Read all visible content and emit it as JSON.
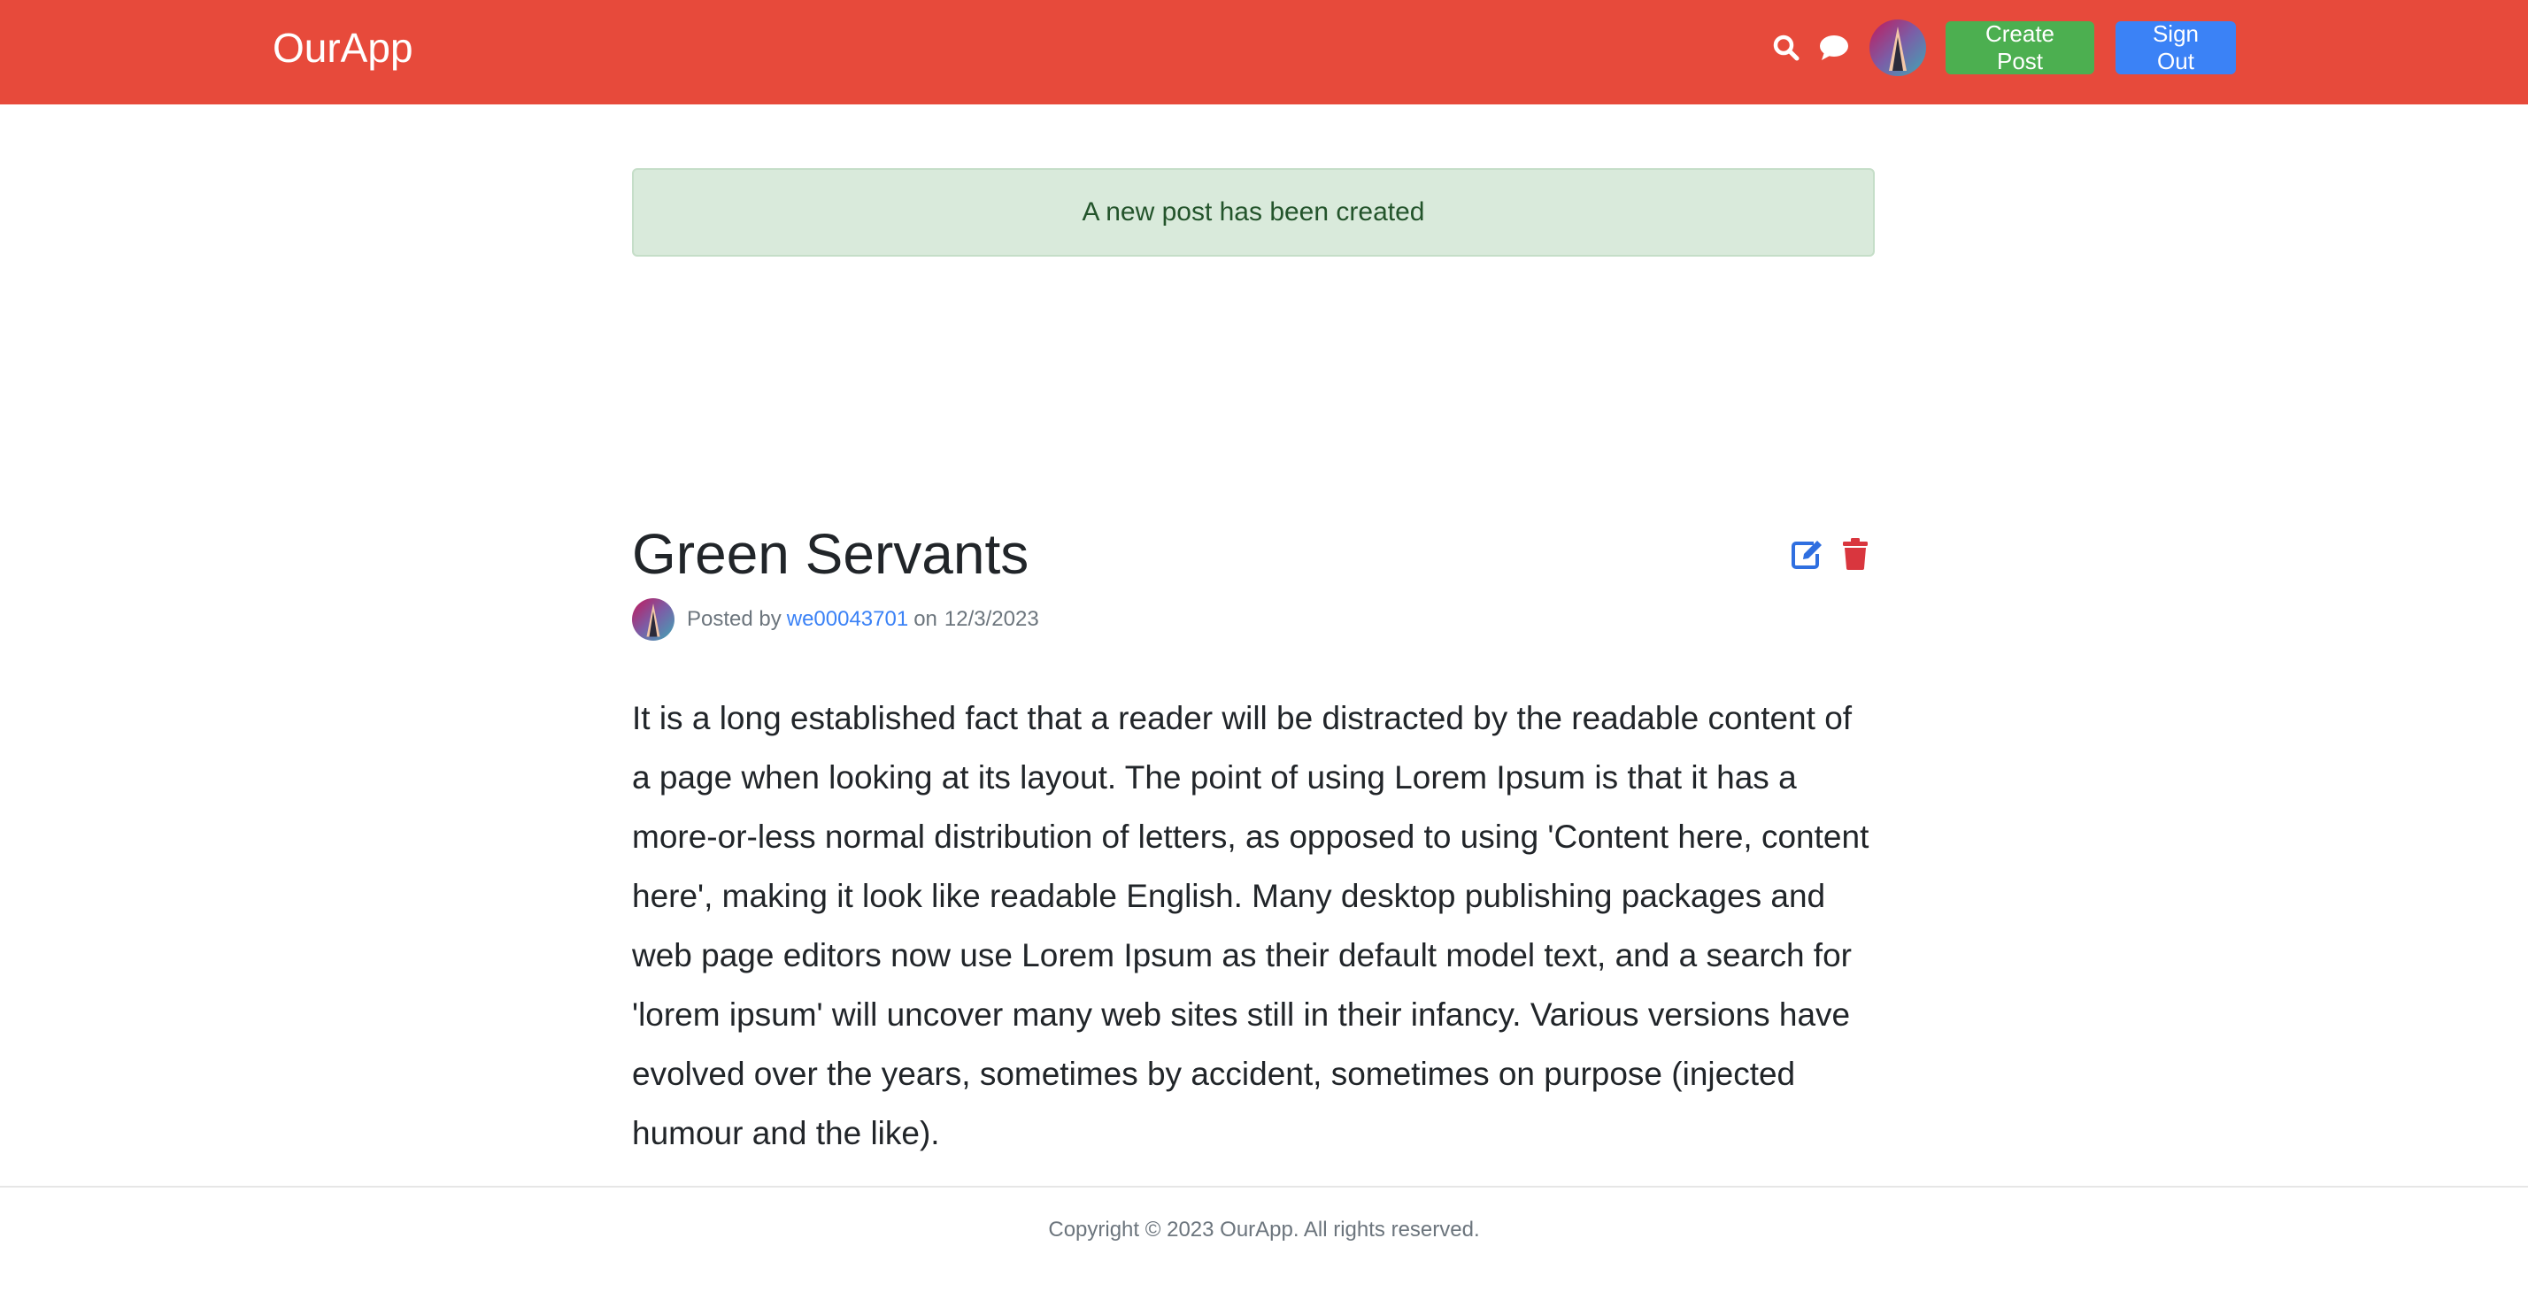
{
  "header": {
    "brand": "OurApp",
    "icons": {
      "search": "search-icon",
      "chat": "chat-icon"
    },
    "create_label": "Create Post",
    "signout_label": "Sign Out",
    "colors": {
      "bar": "#e74a3b",
      "create": "#4caf50",
      "signout": "#3b82f6"
    }
  },
  "flash": {
    "message": "A new post has been created",
    "colors": {
      "background": "#d9eadb",
      "text": "#23542b"
    }
  },
  "post": {
    "title": "Green Servants",
    "actions": {
      "edit": "edit-icon",
      "delete": "trash-icon"
    },
    "meta": {
      "posted_by": "Posted by",
      "author": "we00043701",
      "on": "on",
      "date": "12/3/2023"
    },
    "body": "It is a long established fact that a reader will be distracted by the readable content of a page when looking at its layout. The point of using Lorem Ipsum is that it has a more-or-less normal distribution of letters, as opposed to using 'Content here, content here', making it look like readable English. Many desktop publishing packages and web page editors now use Lorem Ipsum as their default model text, and a search for 'lorem ipsum' will uncover many web sites still in their infancy. Various versions have evolved over the years, sometimes by accident, sometimes on purpose (injected humour and the like)."
  },
  "footer": {
    "copyright": "Copyright © 2023 OurApp. All rights reserved."
  }
}
